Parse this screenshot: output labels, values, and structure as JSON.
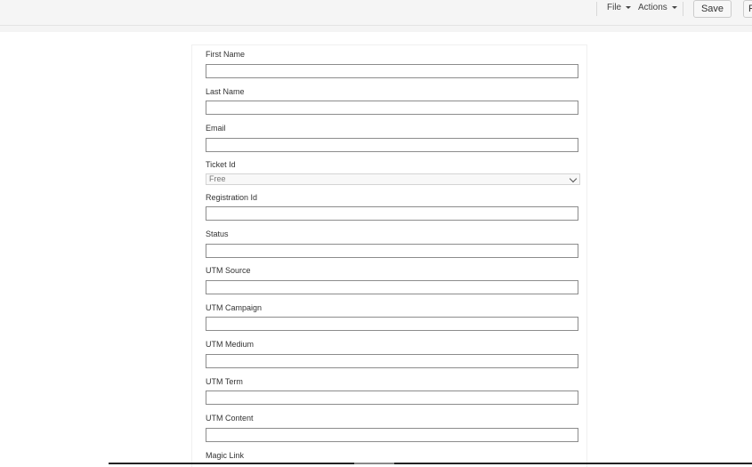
{
  "toolbar": {
    "file_label": "File",
    "actions_label": "Actions",
    "save_label": "Save",
    "partial_button_label": "F"
  },
  "form": {
    "fields": [
      {
        "label": "First Name",
        "type": "text",
        "value": ""
      },
      {
        "label": "Last Name",
        "type": "text",
        "value": ""
      },
      {
        "label": "Email",
        "type": "text",
        "value": ""
      },
      {
        "label": "Ticket Id",
        "type": "select",
        "value": "Free"
      },
      {
        "label": "Registration Id",
        "type": "text",
        "value": ""
      },
      {
        "label": "Status",
        "type": "text",
        "value": ""
      },
      {
        "label": "UTM Source",
        "type": "text",
        "value": ""
      },
      {
        "label": "UTM Campaign",
        "type": "text",
        "value": ""
      },
      {
        "label": "UTM Medium",
        "type": "text",
        "value": ""
      },
      {
        "label": "UTM Term",
        "type": "text",
        "value": ""
      },
      {
        "label": "UTM Content",
        "type": "text",
        "value": ""
      },
      {
        "label": "Magic Link",
        "type": "text",
        "value": ""
      }
    ]
  }
}
